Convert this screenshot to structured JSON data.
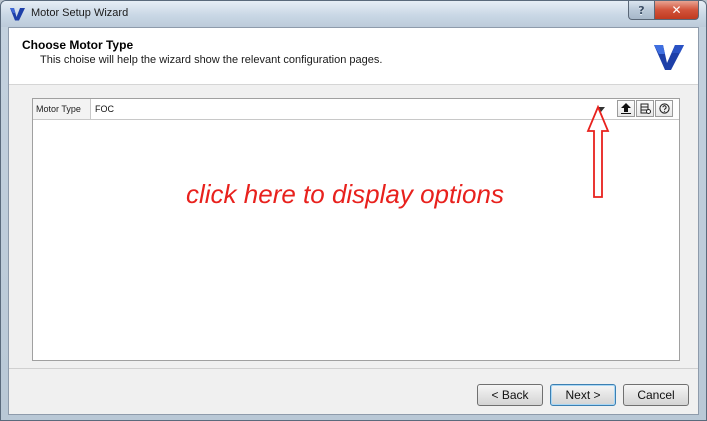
{
  "window": {
    "title": "Motor Setup Wizard",
    "help_glyph": "?",
    "close_glyph": "✕"
  },
  "header": {
    "title": "Choose Motor Type",
    "subtitle": "This choise will help the wizard show the relevant configuration pages."
  },
  "property": {
    "label": "Motor Type",
    "value": "FOC"
  },
  "toolbar": {
    "icons": [
      "dropdown-arrow-icon",
      "upload-icon",
      "database-icon",
      "help-circle-icon"
    ]
  },
  "annotation": {
    "text": "click here to display options",
    "color": "#e8211d"
  },
  "footer": {
    "back_label": "< Back",
    "next_label": "Next >",
    "cancel_label": "Cancel"
  },
  "colors": {
    "accent": "#3c7fb1",
    "brand": "#1d3fa8"
  }
}
